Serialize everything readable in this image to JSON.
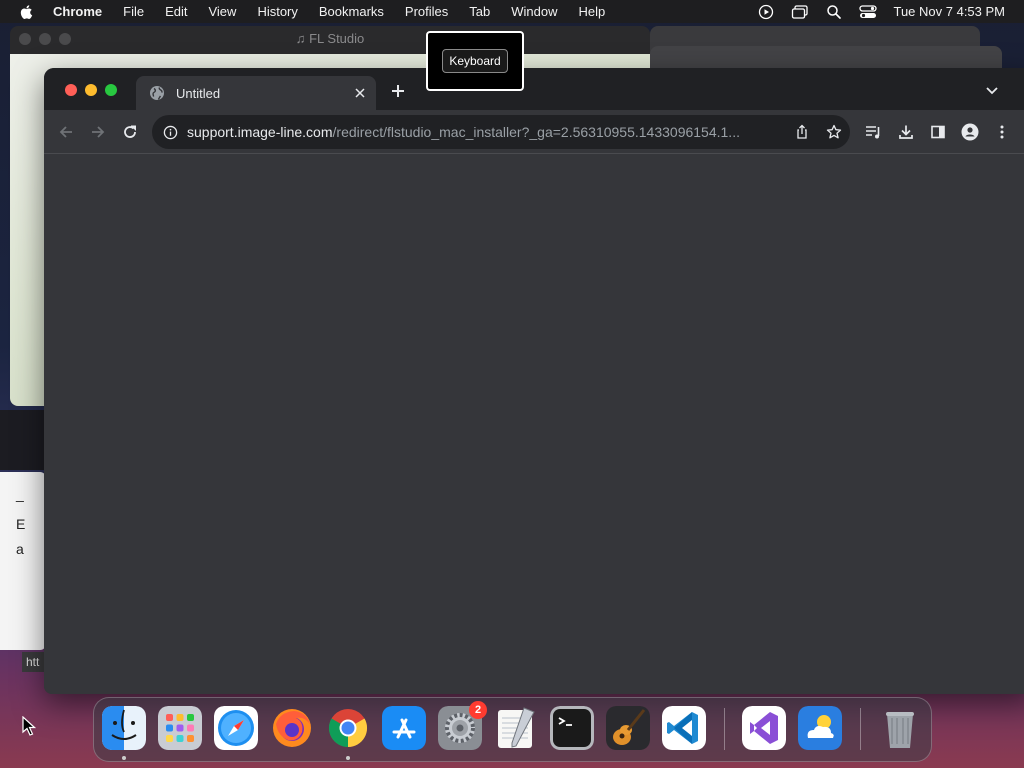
{
  "menubar": {
    "app_name": "Chrome",
    "items": [
      "File",
      "Edit",
      "View",
      "History",
      "Bookmarks",
      "Profiles",
      "Tab",
      "Window",
      "Help"
    ],
    "clock": "Tue Nov 7  4:53 PM",
    "status_icons": [
      "screen-record-icon",
      "screen-mirroring-icon",
      "spotlight-search-icon",
      "control-center-icon"
    ]
  },
  "background": {
    "fl_studio_title": "FL Studio",
    "left_window_lines": [
      "_",
      "E",
      "a"
    ],
    "status_link": "htt"
  },
  "tooltip": {
    "label": "Keyboard"
  },
  "browser": {
    "tab_title": "Untitled",
    "url_host": "support.image-line.com",
    "url_path": "/redirect/flstudio_mac_installer?_ga=2.56310955.1433096154.1..."
  },
  "dock": {
    "apps": [
      "Finder",
      "Launchpad",
      "Safari",
      "Firefox",
      "Google Chrome",
      "App Store",
      "System Settings",
      "TextEdit",
      "Terminal",
      "GarageBand",
      "Visual Studio Code",
      "Visual Studio",
      "Weather",
      "Trash"
    ],
    "system_settings_badge": "2"
  },
  "colors": {
    "window_bg": "#35363a",
    "tabstrip_bg": "#202124",
    "close": "#ff5f57",
    "minimize": "#febc2e",
    "zoom": "#28c840",
    "badge": "#ff3b30"
  }
}
